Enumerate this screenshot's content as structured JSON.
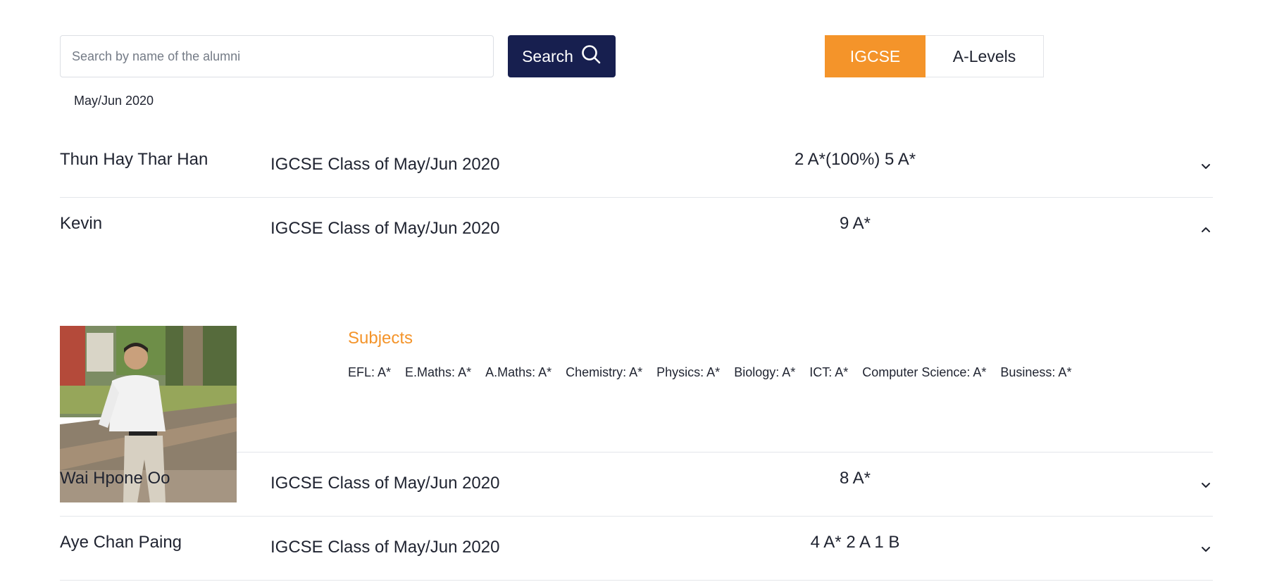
{
  "search": {
    "placeholder": "Search by name of the alumni",
    "value": "",
    "button_label": "Search",
    "button_icon": "search-icon"
  },
  "tabs": [
    {
      "label": "IGCSE",
      "active": true
    },
    {
      "label": "A-Levels",
      "active": false
    }
  ],
  "session_label": "May/Jun 2020",
  "colors": {
    "accent": "#f4942a",
    "button": "#171f4f",
    "divider": "#e4e6ea"
  },
  "alumni": [
    {
      "name": "Thun Hay Thar Han",
      "class": "IGCSE Class of May/Jun 2020",
      "result": "2 A*(100%) 5 A*",
      "expanded": false,
      "toggle_icon": "chevron-down-icon"
    },
    {
      "name": "Kevin",
      "class": "IGCSE Class of May/Jun 2020",
      "result": "9 A*",
      "expanded": true,
      "toggle_icon": "chevron-up-icon",
      "subjects_heading": "Subjects",
      "subjects": [
        "EFL: A*",
        "E.Maths: A*",
        "A.Maths: A*",
        "Chemistry: A*",
        "Physics: A*",
        "Biology: A*",
        "ICT: A*",
        "Computer Science: A*",
        "Business: A*"
      ]
    },
    {
      "name": "Wai Hpone Oo",
      "class": "IGCSE Class of May/Jun 2020",
      "result": "8 A*",
      "expanded": false,
      "toggle_icon": "chevron-down-icon"
    },
    {
      "name": "Aye Chan Paing",
      "class": "IGCSE Class of May/Jun 2020",
      "result": "4 A* 2 A 1 B",
      "expanded": false,
      "toggle_icon": "chevron-down-icon"
    }
  ]
}
